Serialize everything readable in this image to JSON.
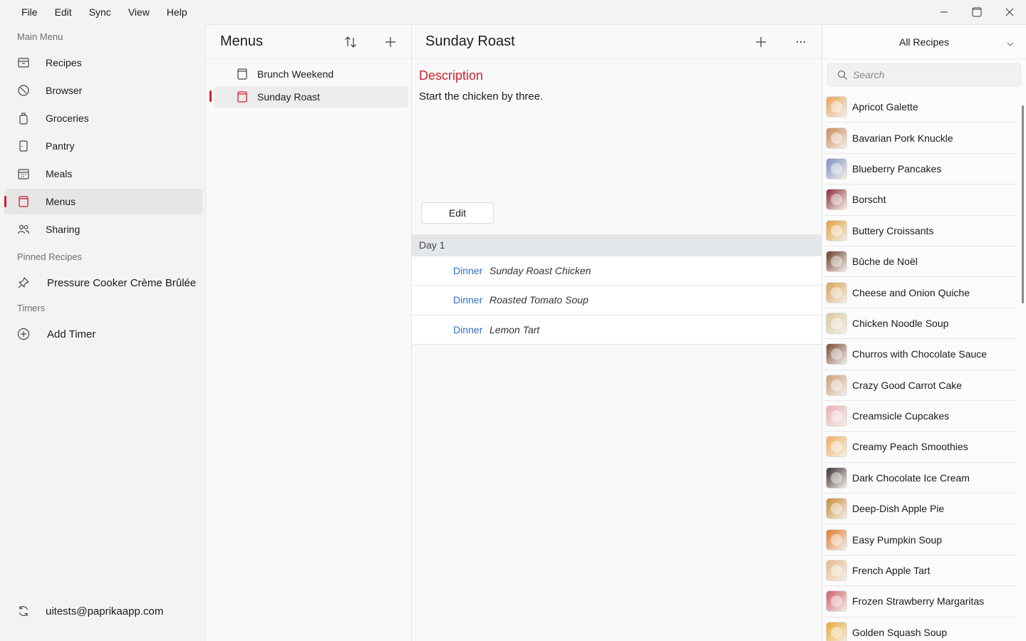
{
  "menubar": {
    "items": [
      "File",
      "Edit",
      "Sync",
      "View",
      "Help"
    ]
  },
  "window_controls": {
    "icons": [
      "minimize-icon",
      "maximize-icon",
      "close-icon"
    ]
  },
  "sidebar": {
    "main_menu_label": "Main Menu",
    "items": [
      {
        "label": "Recipes",
        "icon": "recipe-box-icon"
      },
      {
        "label": "Browser",
        "icon": "compass-icon"
      },
      {
        "label": "Groceries",
        "icon": "grocery-bag-icon"
      },
      {
        "label": "Pantry",
        "icon": "pantry-icon"
      },
      {
        "label": "Meals",
        "icon": "calendar-icon"
      },
      {
        "label": "Menus",
        "icon": "menu-book-icon",
        "active": true
      },
      {
        "label": "Sharing",
        "icon": "people-icon"
      }
    ],
    "pinned_label": "Pinned Recipes",
    "pinned": [
      {
        "label": "Pressure Cooker Crème Brûlée",
        "icon": "pin-icon"
      }
    ],
    "timers_label": "Timers",
    "add_timer_label": "Add Timer",
    "account_email": "uitests@paprikaapp.com"
  },
  "menus_panel": {
    "title": "Menus",
    "items": [
      {
        "label": "Brunch Weekend",
        "active": false
      },
      {
        "label": "Sunday Roast",
        "active": true
      }
    ]
  },
  "detail": {
    "title": "Sunday Roast",
    "description_heading": "Description",
    "description_text": "Start the chicken by three.",
    "edit_label": "Edit",
    "day_label": "Day 1",
    "meals": [
      {
        "type": "Dinner",
        "name": "Sunday Roast Chicken"
      },
      {
        "type": "Dinner",
        "name": "Roasted Tomato Soup"
      },
      {
        "type": "Dinner",
        "name": "Lemon Tart"
      }
    ]
  },
  "recipes_panel": {
    "selector": "All Recipes",
    "search_placeholder": "Search",
    "recipes": [
      {
        "name": "Apricot Galette",
        "color": "#e8a45a"
      },
      {
        "name": "Bavarian Pork Knuckle",
        "color": "#c98a5c"
      },
      {
        "name": "Blueberry Pancakes",
        "color": "#7a8fc4"
      },
      {
        "name": "Borscht",
        "color": "#8a2f3a"
      },
      {
        "name": "Buttery Croissants",
        "color": "#e0a040"
      },
      {
        "name": "Bûche de Noël",
        "color": "#6b3b2a"
      },
      {
        "name": "Cheese and Onion Quiche",
        "color": "#d9a35a"
      },
      {
        "name": "Chicken Noodle Soup",
        "color": "#d8c79a"
      },
      {
        "name": "Churros with Chocolate Sauce",
        "color": "#7a4a3a"
      },
      {
        "name": "Crazy Good Carrot Cake",
        "color": "#c9a07a"
      },
      {
        "name": "Creamsicle Cupcakes",
        "color": "#e8b0b8"
      },
      {
        "name": "Creamy Peach Smoothies",
        "color": "#f0b060"
      },
      {
        "name": "Dark Chocolate Ice Cream",
        "color": "#3a3030"
      },
      {
        "name": "Deep-Dish Apple Pie",
        "color": "#c88a3a"
      },
      {
        "name": "Easy Pumpkin Soup",
        "color": "#e07a30"
      },
      {
        "name": "French Apple Tart",
        "color": "#e8b890"
      },
      {
        "name": "Frozen Strawberry Margaritas",
        "color": "#d05a6a"
      },
      {
        "name": "Golden Squash Soup",
        "color": "#e8a830"
      }
    ]
  },
  "colors": {
    "accent": "#d1202a",
    "link": "#2f6fc4"
  }
}
